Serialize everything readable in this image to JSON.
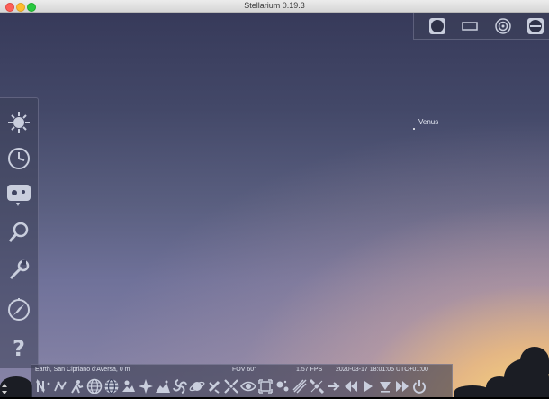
{
  "window": {
    "title": "Stellarium 0.19.3"
  },
  "sky": {
    "object_label": "Venus"
  },
  "status": {
    "location": "Earth, San Cipriano d'Aversa, 0 m",
    "fov": "FOV 60°",
    "fps": "1.57 FPS",
    "datetime": "2020-03-17 18:01:05 UTC+01:00"
  },
  "left_panel": [
    "sky-and-viewing-options-icon",
    "date-time-icon",
    "location-icon",
    "search-icon",
    "configuration-icon",
    "compass-marks-icon",
    "help-icon"
  ],
  "top_right_panel": [
    "ocular-view-icon",
    "sensor-frame-icon",
    "telrad-icon",
    "oculars-config-icon"
  ],
  "bottom_toolbar": [
    "constellation-lines-icon",
    "constellation-labels-icon",
    "constellation-art-icon",
    "equatorial-grid-icon",
    "azimuthal-grid-icon",
    "ground-icon",
    "cardinal-points-icon",
    "atmosphere-icon",
    "deep-sky-objects-icon",
    "planet-labels-icon",
    "equatorial-mount-icon",
    "center-object-icon",
    "night-mode-icon",
    "fullscreen-icon",
    "exoplanets-icon",
    "meteor-showers-icon",
    "satellites-icon",
    "decrease-time-speed-icon",
    "normal-time-icon",
    "now-icon",
    "increase-time-speed-icon",
    "quit-icon"
  ],
  "colors": {
    "icon": "#c9cedd",
    "sky_top": "#373a5a",
    "horizon_glow": "#ffd878"
  }
}
